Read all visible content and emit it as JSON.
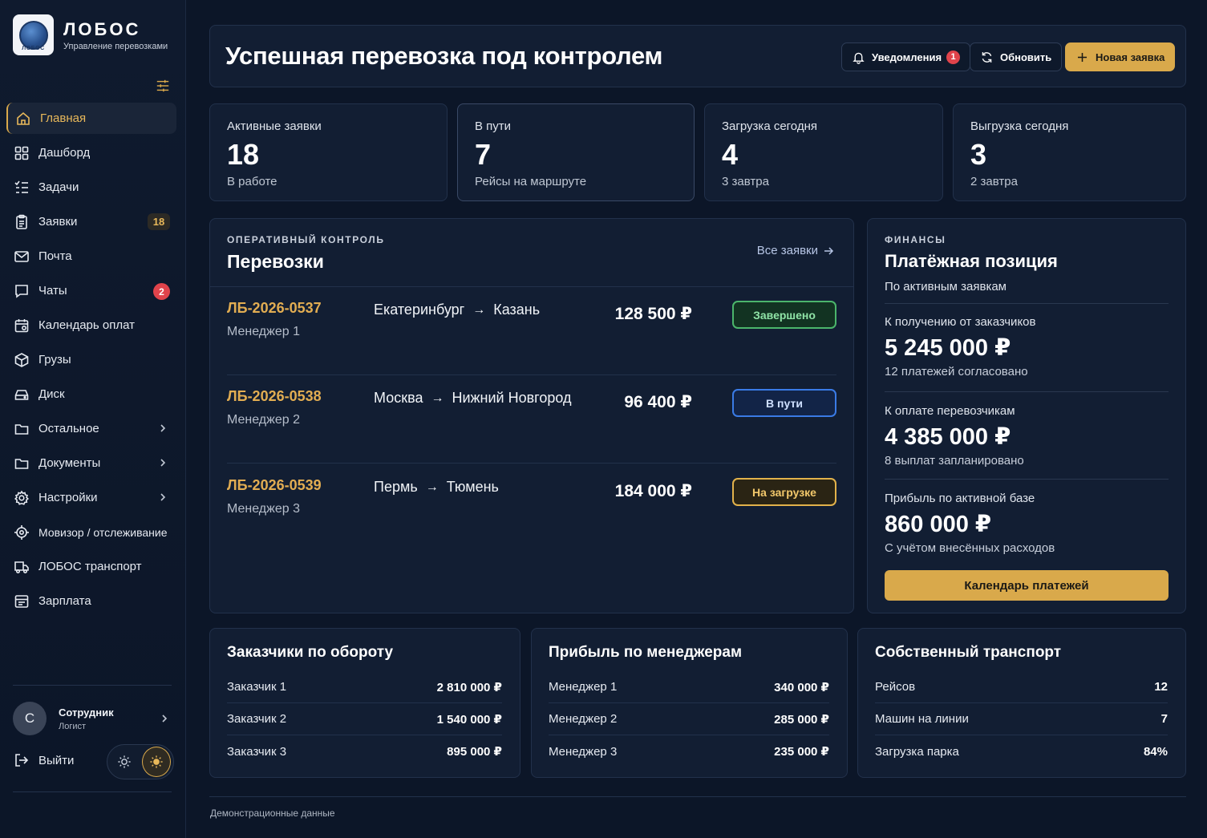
{
  "brand": {
    "name": "ЛОБОС",
    "subtitle": "Управление перевозками",
    "logo_text": "ЛОБОС"
  },
  "sidebar": {
    "items": [
      {
        "label": "Главная",
        "icon": "home-icon",
        "active": true
      },
      {
        "label": "Дашборд",
        "icon": "grid-icon"
      },
      {
        "label": "Задачи",
        "icon": "list-check-icon"
      },
      {
        "label": "Заявки",
        "icon": "clipboard-icon",
        "count": "18"
      },
      {
        "label": "Почта",
        "icon": "mail-icon"
      },
      {
        "label": "Чаты",
        "icon": "chat-icon",
        "count": "2"
      },
      {
        "label": "Календарь оплат",
        "icon": "calendar-icon"
      },
      {
        "label": "Грузы",
        "icon": "package-icon"
      },
      {
        "label": "Диск",
        "icon": "disk-icon"
      },
      {
        "label": "Остальное",
        "icon": "folder-icon"
      },
      {
        "label": "Документы",
        "icon": "folder-icon"
      },
      {
        "label": "Настройки",
        "icon": "gear-icon"
      },
      {
        "label": "Мовизор / отслеживание",
        "icon": "target-icon"
      },
      {
        "label": "ЛОБОС транспорт",
        "icon": "truck-icon"
      },
      {
        "label": "Зарплата",
        "icon": "wallet-icon"
      }
    ]
  },
  "user": {
    "initial": "С",
    "name": "Сотрудник",
    "role": "Логист"
  },
  "logout_label": "Выйти",
  "header": {
    "title": "Успешная перевозка под контролем",
    "notifications_label": "Уведомления",
    "notifications_count": "1",
    "refresh_label": "Обновить",
    "new_request_label": "Новая заявка"
  },
  "stats": [
    {
      "label": "Активные заявки",
      "value": "18",
      "sub": "В работе"
    },
    {
      "label": "В пути",
      "value": "7",
      "sub": "Рейсы на маршруте"
    },
    {
      "label": "Загрузка сегодня",
      "value": "4",
      "sub": "3 завтра"
    },
    {
      "label": "Выгрузка сегодня",
      "value": "3",
      "sub": "2 завтра"
    }
  ],
  "shipments": {
    "kicker": "ОПЕРАТИВНЫЙ КОНТРОЛЬ",
    "title": "Перевозки",
    "all_link": "Все заявки",
    "rows": [
      {
        "id": "ЛБ-2026-0537",
        "manager": "Менеджер 1",
        "from": "Екатеринбург",
        "to": "Казань",
        "amount": "128 500 ₽",
        "status": "Завершено",
        "status_color": "#4bb56b"
      },
      {
        "id": "ЛБ-2026-0538",
        "manager": "Менеджер 2",
        "from": "Москва",
        "to": "Нижний Новгород",
        "amount": "96 400 ₽",
        "status": "В пути",
        "status_color": "#3a7be6"
      },
      {
        "id": "ЛБ-2026-0539",
        "manager": "Менеджер 3",
        "from": "Пермь",
        "to": "Тюмень",
        "amount": "184 000 ₽",
        "status": "На загрузке",
        "status_color": "#e2b24b"
      }
    ]
  },
  "finance": {
    "kicker": "ФИНАНСЫ",
    "title": "Платёжная позиция",
    "subtitle": "По активным заявкам",
    "blocks": [
      {
        "label": "К получению от заказчиков",
        "value": "5 245 000 ₽",
        "note": "12 платежей согласовано"
      },
      {
        "label": "К оплате перевозчикам",
        "value": "4 385 000 ₽",
        "note": "8 выплат запланировано"
      },
      {
        "label": "Прибыль по активной базе",
        "value": "860 000 ₽",
        "note": "С учётом внесённых расходов"
      }
    ],
    "button_label": "Календарь платежей"
  },
  "customers": {
    "title": "Заказчики по обороту",
    "rows": [
      {
        "name": "Заказчик 1",
        "value": "2 810 000 ₽"
      },
      {
        "name": "Заказчик 2",
        "value": "1 540 000 ₽"
      },
      {
        "name": "Заказчик 3",
        "value": "895 000 ₽"
      }
    ]
  },
  "managers": {
    "title": "Прибыль по менеджерам",
    "rows": [
      {
        "name": "Менеджер 1",
        "value": "340 000 ₽"
      },
      {
        "name": "Менеджер 2",
        "value": "285 000 ₽"
      },
      {
        "name": "Менеджер 3",
        "value": "235 000 ₽"
      }
    ]
  },
  "transport": {
    "title": "Собственный транспорт",
    "rows": [
      {
        "name": "Рейсов",
        "value": "12"
      },
      {
        "name": "Машин на линии",
        "value": "7"
      },
      {
        "name": "Загрузка парка",
        "value": "84%"
      }
    ]
  },
  "footer": {
    "text": "Демонстрационные данные"
  },
  "colors": {
    "accent": "#d9a94b",
    "background": "#0c1628",
    "card": "#121e33",
    "danger": "#e0434b"
  }
}
